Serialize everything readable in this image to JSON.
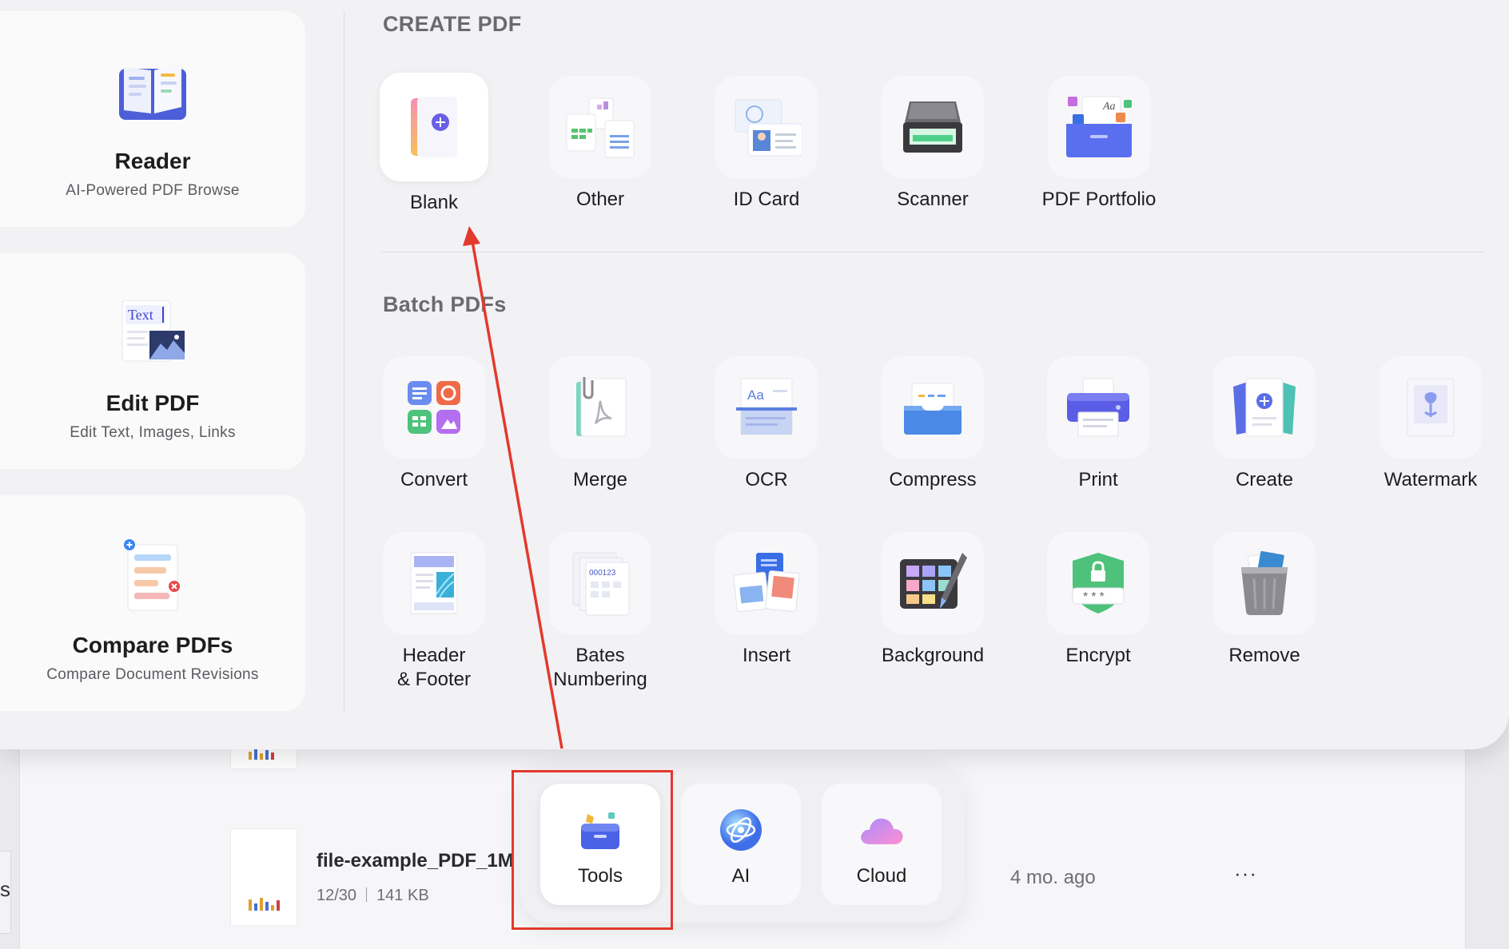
{
  "sidebar": {
    "cards": [
      {
        "title": "Reader",
        "subtitle": "AI-Powered PDF Browse",
        "icon": "book-icon"
      },
      {
        "title": "Edit PDF",
        "subtitle": "Edit Text, Images, Links",
        "icon": "edit-text-icon",
        "icon_text": "Text"
      },
      {
        "title": "Compare PDFs",
        "subtitle": "Compare Document Revisions",
        "icon": "compare-icon"
      }
    ]
  },
  "create": {
    "title": "CREATE PDF",
    "items": [
      {
        "label": "Blank",
        "icon": "blank-page-icon"
      },
      {
        "label": "Other",
        "icon": "other-files-icon"
      },
      {
        "label": "ID Card",
        "icon": "id-card-icon"
      },
      {
        "label": "Scanner",
        "icon": "scanner-icon"
      },
      {
        "label": "PDF Portfolio",
        "icon": "portfolio-icon",
        "icon_text": "Aa"
      }
    ]
  },
  "batch": {
    "title": "Batch PDFs",
    "row1": [
      {
        "label": "Convert",
        "icon": "convert-icon"
      },
      {
        "label": "Merge",
        "icon": "merge-icon"
      },
      {
        "label": "OCR",
        "icon": "ocr-icon",
        "icon_text": "Aa"
      },
      {
        "label": "Compress",
        "icon": "compress-icon"
      },
      {
        "label": "Print",
        "icon": "print-icon"
      },
      {
        "label": "Create",
        "icon": "create-icon"
      },
      {
        "label": "Watermark",
        "icon": "watermark-icon"
      }
    ],
    "row2": [
      {
        "label": "Header\n& Footer",
        "icon": "header-footer-icon"
      },
      {
        "label": "Bates\nNumbering",
        "icon": "bates-numbering-icon",
        "icon_text": "000123"
      },
      {
        "label": "Insert",
        "icon": "insert-icon"
      },
      {
        "label": "Background",
        "icon": "background-icon"
      },
      {
        "label": "Encrypt",
        "icon": "encrypt-icon",
        "icon_text": "***"
      },
      {
        "label": "Remove",
        "icon": "remove-icon"
      }
    ]
  },
  "dock": {
    "items": [
      {
        "label": "Tools",
        "icon": "tools-icon",
        "active": true
      },
      {
        "label": "AI",
        "icon": "ai-icon"
      },
      {
        "label": "Cloud",
        "icon": "cloud-icon"
      }
    ]
  },
  "file": {
    "name": "file-example_PDF_1M",
    "pages": "12/30",
    "size": "141 KB",
    "modified": "4 mo. ago",
    "more": "···"
  },
  "background_partial_text": "s",
  "colors": {
    "highlight": "#e3392e",
    "accent": "#5a5ce6"
  }
}
